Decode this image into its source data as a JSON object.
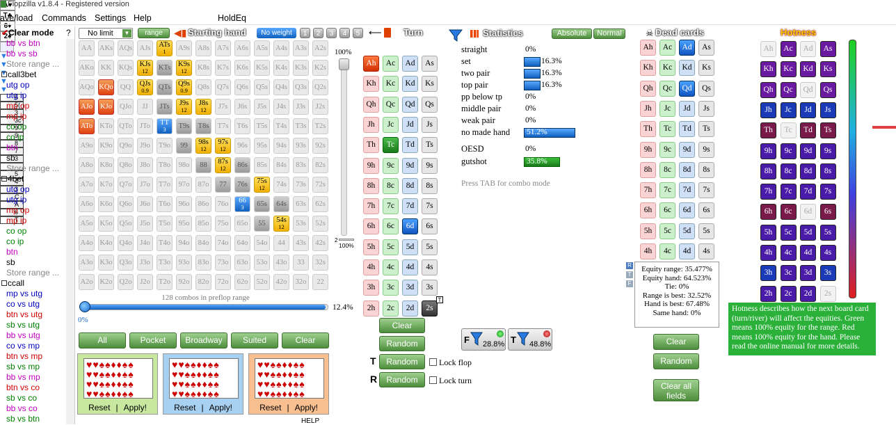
{
  "window": {
    "title": "Flopzilla v1.8.4 - Registered version"
  },
  "menu": {
    "items": [
      "ave/load",
      "Commands",
      "Settings",
      "Help",
      "HoldEq"
    ]
  },
  "sidebar": {
    "clear_mode": "Clear mode",
    "help": "?",
    "items": [
      {
        "t": "bb vs btn",
        "c": "#c000c0"
      },
      {
        "t": "bb vs sb",
        "c": "#c000c0"
      },
      {
        "t": "Store range ...",
        "c": "#888"
      },
      {
        "t": "call3bet",
        "c": "#000",
        "h": true
      },
      {
        "t": "utg op",
        "c": "#0000c0"
      },
      {
        "t": "utg ip",
        "c": "#0000c0"
      },
      {
        "t": "mp op",
        "c": "#d00000"
      },
      {
        "t": "mp ip",
        "c": "#d00000"
      },
      {
        "t": "co op",
        "c": "#008000"
      },
      {
        "t": "co ip",
        "c": "#008000"
      },
      {
        "t": "btn",
        "c": "#c000c0"
      },
      {
        "t": "sb",
        "c": "#000"
      },
      {
        "t": "Store range ...",
        "c": "#888"
      },
      {
        "t": "4bet",
        "c": "#000",
        "h": true
      },
      {
        "t": "utg op",
        "c": "#0000c0"
      },
      {
        "t": "utg ip",
        "c": "#0000c0"
      },
      {
        "t": "mp op",
        "c": "#d00000"
      },
      {
        "t": "mp ip",
        "c": "#d00000"
      },
      {
        "t": "co op",
        "c": "#008000"
      },
      {
        "t": "co ip",
        "c": "#008000"
      },
      {
        "t": "btn",
        "c": "#c000c0"
      },
      {
        "t": "sb",
        "c": "#000"
      },
      {
        "t": "Store range ...",
        "c": "#888"
      },
      {
        "t": "ccall",
        "c": "#000",
        "h": true
      },
      {
        "t": "mp vs utg",
        "c": "#0000c0"
      },
      {
        "t": "co vs utg",
        "c": "#0000c0"
      },
      {
        "t": "btn vs utg",
        "c": "#d00000"
      },
      {
        "t": "sb vs utg",
        "c": "#008000"
      },
      {
        "t": "bb vs utg",
        "c": "#c000c0"
      },
      {
        "t": "co vs mp",
        "c": "#0000c0"
      },
      {
        "t": "btn vs mp",
        "c": "#d00000"
      },
      {
        "t": "sb vs mp",
        "c": "#008000"
      },
      {
        "t": "bb vs mp",
        "c": "#c000c0"
      },
      {
        "t": "btn vs co",
        "c": "#d00000"
      },
      {
        "t": "sb vs co",
        "c": "#008000"
      },
      {
        "t": "bb vs co",
        "c": "#c000c0"
      },
      {
        "t": "sb vs btn",
        "c": "#008000"
      }
    ]
  },
  "range": {
    "limit": "No limit",
    "range_btn": "range",
    "title": "Starting hand",
    "weight_btn": "No weight",
    "weights": [
      "1",
      "2",
      "3",
      "4",
      "5"
    ],
    "combos": "128 combos in preflop range",
    "pct_right": "12.4%",
    "pct_left": "0%",
    "vpct_top": "100%",
    "vpct_bottom": "100%",
    "v2": "2",
    "buttons": [
      "All",
      "Pocket",
      "Broadway",
      "Suited",
      "Clear"
    ],
    "presets": [
      {
        "reset": "Reset",
        "sep": "|",
        "apply": "Apply!",
        "color": "#c8e8a0"
      },
      {
        "reset": "Reset",
        "sep": "|",
        "apply": "Apply!",
        "color": "#a8d0f0"
      },
      {
        "reset": "Reset",
        "sep": "|",
        "apply": "Apply!",
        "color": "#f8c090"
      }
    ],
    "help": "HELP",
    "grid": [
      [
        "AA",
        "AKs",
        "AQs",
        "AJs",
        "ATs",
        "A9s",
        "A8s",
        "A7s",
        "A6s",
        "A5s",
        "A4s",
        "A3s",
        "A2s"
      ],
      [
        "AKo",
        "KK",
        "KQs",
        "KJs",
        "KTs",
        "K9s",
        "K8s",
        "K7s",
        "K6s",
        "K5s",
        "K4s",
        "K3s",
        "K2s"
      ],
      [
        "AQo",
        "KQo",
        "QQ",
        "QJs",
        "QTs",
        "Q9s",
        "Q8s",
        "Q7s",
        "Q6s",
        "Q5s",
        "Q4s",
        "Q3s",
        "Q2s"
      ],
      [
        "AJo",
        "KJo",
        "QJo",
        "JJ",
        "JTs",
        "J9s",
        "J8s",
        "J7s",
        "J6s",
        "J5s",
        "J4s",
        "J3s",
        "J2s"
      ],
      [
        "ATo",
        "KTo",
        "QTo",
        "JTo",
        "TT",
        "T9s",
        "T8s",
        "T7s",
        "T6s",
        "T5s",
        "T4s",
        "T3s",
        "T2s"
      ],
      [
        "A9o",
        "K9o",
        "Q9o",
        "J9o",
        "T9o",
        "99",
        "98s",
        "97s",
        "96s",
        "95s",
        "94s",
        "93s",
        "92s"
      ],
      [
        "A8o",
        "K8o",
        "Q8o",
        "J8o",
        "T8o",
        "98o",
        "88",
        "87s",
        "86s",
        "85s",
        "84s",
        "83s",
        "82s"
      ],
      [
        "A7o",
        "K7o",
        "Q7o",
        "J7o",
        "T7o",
        "97o",
        "87o",
        "77",
        "76s",
        "75s",
        "74s",
        "73s",
        "72s"
      ],
      [
        "A6o",
        "K6o",
        "Q6o",
        "J6o",
        "T6o",
        "96o",
        "86o",
        "76o",
        "66",
        "65s",
        "64s",
        "63s",
        "62s"
      ],
      [
        "A5o",
        "K5o",
        "Q5o",
        "J5o",
        "T5o",
        "95o",
        "85o",
        "75o",
        "65o",
        "55",
        "54s",
        "53s",
        "52s"
      ],
      [
        "A4o",
        "K4o",
        "Q4o",
        "J4o",
        "T4o",
        "94o",
        "84o",
        "74o",
        "64o",
        "54o",
        "44",
        "43s",
        "42s"
      ],
      [
        "A3o",
        "K3o",
        "Q3o",
        "J3o",
        "T3o",
        "93o",
        "83o",
        "73o",
        "63o",
        "53o",
        "43o",
        "33",
        "32s"
      ],
      [
        "A2o",
        "K2o",
        "Q2o",
        "J2o",
        "T2o",
        "92o",
        "82o",
        "72o",
        "62o",
        "52o",
        "42o",
        "32o",
        "22"
      ]
    ],
    "special": {
      "0,4": {
        "s": "ye",
        "n": "1"
      },
      "1,3": {
        "s": "ye",
        "n": "12"
      },
      "1,4": {
        "s": "gr",
        "n": ""
      },
      "1,5": {
        "s": "ye",
        "n": "12"
      },
      "2,1": {
        "s": "or",
        "n": "2.7"
      },
      "2,3": {
        "s": "ye",
        "n": "0.9"
      },
      "2,4": {
        "s": "gr",
        "n": ""
      },
      "2,5": {
        "s": "ye",
        "n": "0.9"
      },
      "3,0": {
        "s": "or",
        "n": "6"
      },
      "3,1": {
        "s": "or",
        "n": "3.6"
      },
      "3,4": {
        "s": "gr",
        "n": ""
      },
      "3,5": {
        "s": "ye",
        "n": "12"
      },
      "3,6": {
        "s": "ye",
        "n": "12"
      },
      "4,0": {
        "s": "or",
        "n": "5"
      },
      "4,4": {
        "s": "bl",
        "n": "3"
      },
      "4,5": {
        "s": "gr",
        "n": ""
      },
      "4,6": {
        "s": "gr",
        "n": ""
      },
      "5,5": {
        "s": "gr",
        "n": ""
      },
      "5,6": {
        "s": "ye",
        "n": "12"
      },
      "5,7": {
        "s": "ye",
        "n": "12"
      },
      "6,6": {
        "s": "gr",
        "n": ""
      },
      "6,7": {
        "s": "ye",
        "n": "12"
      },
      "6,8": {
        "s": "gr",
        "n": ""
      },
      "7,7": {
        "s": "gr",
        "n": ""
      },
      "7,8": {
        "s": "gr",
        "n": ""
      },
      "7,9": {
        "s": "ye",
        "n": "12"
      },
      "8,8": {
        "s": "bl",
        "n": "3"
      },
      "8,9": {
        "s": "gr",
        "n": ""
      },
      "8,10": {
        "s": "gr",
        "n": ""
      },
      "9,9": {
        "s": "gr",
        "n": ""
      },
      "9,10": {
        "s": "ye",
        "n": "12"
      }
    }
  },
  "turn": {
    "title": "Turn",
    "suits": [
      "A♥",
      "T♣",
      "6♦",
      "2♠"
    ],
    "ranks": [
      "A",
      "K",
      "Q",
      "J",
      "T",
      "9",
      "8",
      "7",
      "6",
      "5",
      "4",
      "3",
      "2"
    ],
    "suit_letters": [
      "h",
      "c",
      "d",
      "s"
    ],
    "selected": [
      "Ah",
      "Tc",
      "6d",
      "2s"
    ],
    "clear": "Clear",
    "random": "Random",
    "tflop_random": "Random",
    "lock_flop": "Lock flop",
    "rriver_random": "Random",
    "lock_turn": "Lock turn",
    "t_badge": "T",
    "r_badge": "R"
  },
  "stats": {
    "title": "Statistics",
    "absolute": "Absolute",
    "normal": "Normal",
    "rows": [
      {
        "l": "straight",
        "v": "0%",
        "pct": 0
      },
      {
        "l": "set",
        "v": "16.3%",
        "pct": 16.3
      },
      {
        "l": "two pair",
        "v": "16.3%",
        "pct": 16.3
      },
      {
        "l": "top pair",
        "v": "16.3%",
        "pct": 16.3
      },
      {
        "l": "pp below tp",
        "v": "0%",
        "pct": 0
      },
      {
        "l": "middle pair",
        "v": "0%",
        "pct": 0
      },
      {
        "l": "weak pair",
        "v": "0%",
        "pct": 0
      },
      {
        "l": "no made hand",
        "v": "51.2%",
        "pct": 51.2
      }
    ],
    "draws": [
      {
        "l": "OESD",
        "v": "0%",
        "pct": 0
      },
      {
        "l": "gutshot",
        "v": "35.8%",
        "pct": 35.8
      }
    ],
    "tab_hint": "Press TAB for combo mode",
    "filter_f": "28.8%",
    "filter_t": "48.8%",
    "f_label": "F",
    "t_label": "T"
  },
  "dead": {
    "title": "Dead cards",
    "selected": [
      "Ad",
      "Qd"
    ],
    "clear": "Clear",
    "random": "Random",
    "clear_all": "Clear all fields"
  },
  "equity": {
    "lines": [
      "Equity range: 35.477%",
      "Equity hand: 64.523%",
      "Tie: 0%",
      "",
      "Range is best: 32.52%",
      "Hand is best: 67.48%",
      "Same hand: 0%"
    ],
    "badges": [
      "R",
      "T",
      "F"
    ]
  },
  "hotness": {
    "title": "Hotness",
    "desc": "Hotness describes how the next board card (turn/river) will affect the equities. Green means 100% equity for the range. Red means 100% equity for the hand. Please read the online manual for more details.",
    "grid": [
      [
        "Ah:hg",
        "Ac:hp",
        "Ad:hg",
        "As:hp"
      ],
      [
        "Kh:hp",
        "Kc:hp",
        "Kd:hp",
        "Ks:hp"
      ],
      [
        "Qh:hp",
        "Qc:hp",
        "Qd:hg",
        "Qs:hp"
      ],
      [
        "Jh:hb",
        "Jc:hb",
        "Jd:hb",
        "Js:hb"
      ],
      [
        "Th:hm",
        "Tc:hg",
        "Td:hm",
        "Ts:hm"
      ],
      [
        "9h:hv",
        "9c:hv",
        "9d:hv",
        "9s:hv"
      ],
      [
        "8h:hv",
        "8c:hv",
        "8d:hv",
        "8s:hv"
      ],
      [
        "7h:hv",
        "7c:hv",
        "7d:hv",
        "7s:hv"
      ],
      [
        "6h:hm",
        "6c:hm",
        "6d:hg",
        "6s:hm"
      ],
      [
        "5h:hv",
        "5c:hv",
        "5d:hv",
        "5s:hv"
      ],
      [
        "4h:hv",
        "4c:hv",
        "4d:hv",
        "4s:hv"
      ],
      [
        "3h:hb",
        "3c:hv",
        "3d:hv",
        "3s:hb"
      ],
      [
        "2h:hv",
        "2c:hv",
        "2d:hv",
        "2s:hg"
      ]
    ]
  },
  "rightcol": {
    "items": [
      "5",
      "5(",
      "3",
      "3c",
      "9",
      "9",
      "8",
      "7",
      "3",
      "",
      "5",
      "4",
      "3",
      "C",
      "A",
      "6",
      "T"
    ]
  }
}
